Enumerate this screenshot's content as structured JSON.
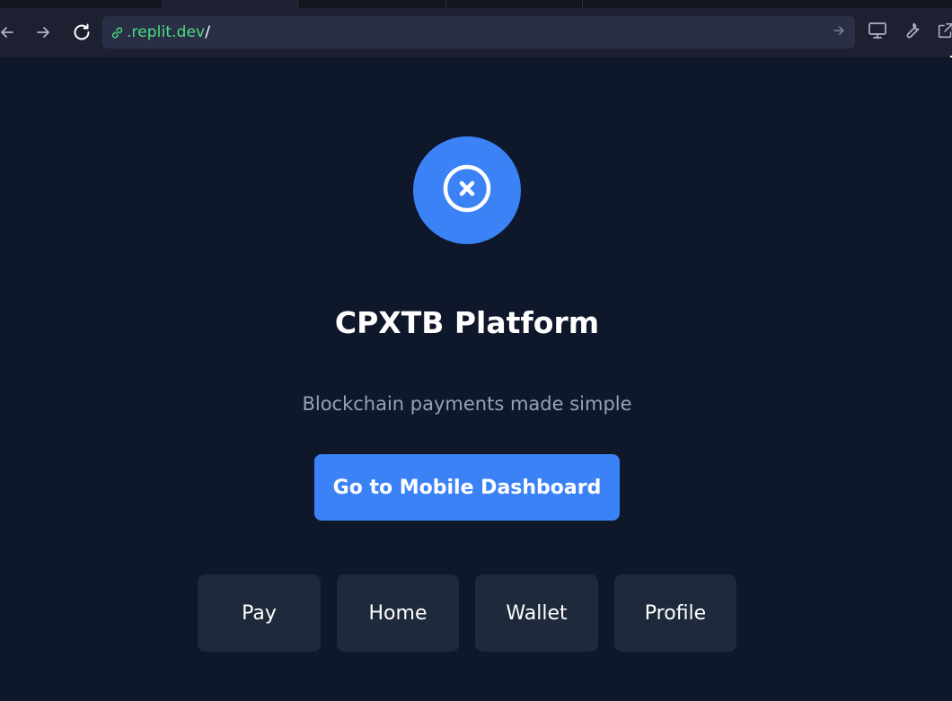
{
  "browser": {
    "url_domain": ".replit.dev",
    "url_path": "/"
  },
  "icons": {
    "back": "arrow-left-icon",
    "forward": "arrow-right-icon",
    "reload": "reload-icon",
    "link": "link-icon",
    "go": "arrow-right-icon",
    "devices": "monitor-icon",
    "tools": "wrench-icon",
    "open_external": "open-external-icon",
    "logo": "circle-x-icon"
  },
  "colors": {
    "background": "#0f172a",
    "accent": "#3b82f6",
    "tile": "#1e293b",
    "subtitle": "#94a3b8",
    "url_domain": "#4ade80"
  },
  "hero": {
    "title": "CPXTB Platform",
    "subtitle": "Blockchain payments made simple",
    "cta_label": "Go to Mobile Dashboard"
  },
  "nav_tiles": [
    {
      "label": "Pay"
    },
    {
      "label": "Home"
    },
    {
      "label": "Wallet"
    },
    {
      "label": "Profile"
    }
  ]
}
